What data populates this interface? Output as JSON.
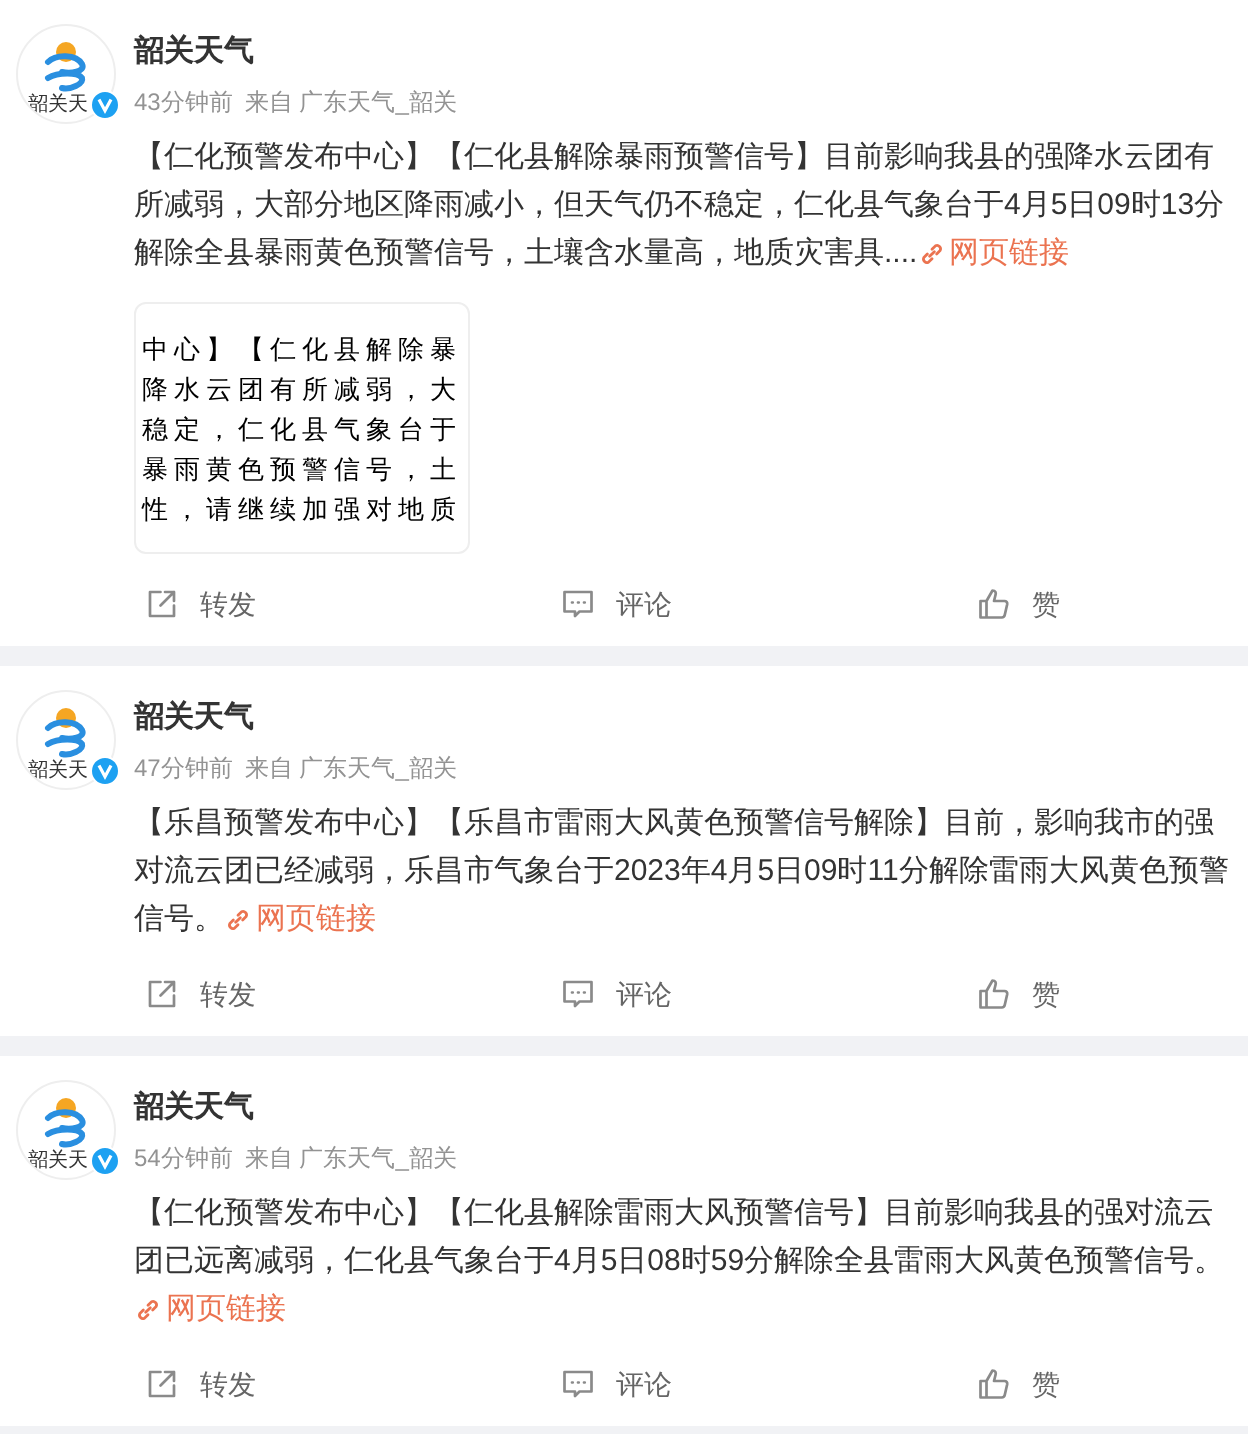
{
  "posts": [
    {
      "author": "韶关天气",
      "avatar_text": "韶关天",
      "verified": true,
      "time": "43分钟前",
      "source_prefix": "来自",
      "source": "广东天气_韶关",
      "text": "【仁化预警发布中心】【仁化县解除暴雨预警信号】目前影响我县的强降水云团有所减弱，大部分地区降雨减小，但天气仍不稳定，仁化县气象台于4月5日09时13分解除全县暴雨黄色预警信号，土壤含水量高，地质灾害具....",
      "link": "网页链接",
      "image_lines": [
        "中心】【仁化县解除暴",
        "降水云团有所减弱，大",
        "稳定，仁化县气象台于",
        "暴雨黄色预警信号，土",
        "性，请继续加强对地质"
      ],
      "actions": [
        {
          "kind": "repost",
          "label": "转发"
        },
        {
          "kind": "comment",
          "label": "评论"
        },
        {
          "kind": "like",
          "label": "赞"
        }
      ]
    },
    {
      "author": "韶关天气",
      "avatar_text": "韶关天",
      "verified": true,
      "time": "47分钟前",
      "source_prefix": "来自",
      "source": "广东天气_韶关",
      "text": "【乐昌预警发布中心】【乐昌市雷雨大风黄色预警信号解除】目前，影响我市的强对流云团已经减弱，乐昌市气象台于2023年4月5日09时11分解除雷雨大风黄色预警信号。",
      "link": "网页链接",
      "actions": [
        {
          "kind": "repost",
          "label": "转发"
        },
        {
          "kind": "comment",
          "label": "评论"
        },
        {
          "kind": "like",
          "label": "赞"
        }
      ]
    },
    {
      "author": "韶关天气",
      "avatar_text": "韶关天",
      "verified": true,
      "time": "54分钟前",
      "source_prefix": "来自",
      "source": "广东天气_韶关",
      "text": "【仁化预警发布中心】【仁化县解除雷雨大风预警信号】目前影响我县的强对流云团已远离减弱，仁化县气象台于4月5日08时59分解除全县雷雨大风黄色预警信号。",
      "link": "网页链接",
      "actions": [
        {
          "kind": "repost",
          "label": "转发"
        },
        {
          "kind": "comment",
          "label": "评论"
        },
        {
          "kind": "like",
          "label": "赞"
        }
      ]
    }
  ]
}
